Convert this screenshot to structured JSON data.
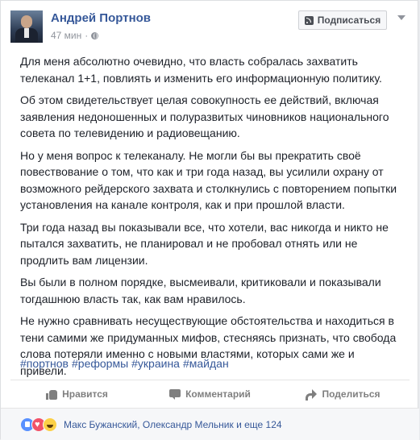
{
  "post": {
    "author": "Андрей Портнов",
    "time": "47 мин",
    "subscribe_label": "Подписаться",
    "paragraphs": [
      "Для меня абсолютно очевидно, что власть собралась захватить телеканал 1+1, повлиять и изменить его информационную политику.",
      "Об этом свидетельствует целая совокупность ее действий, включая заявления недоношенных и полуразвитых чиновников национального совета по телевидению и радиовещанию.",
      "Но у меня вопрос к телеканалу. Не могли бы вы прекратить своё повествование о том, что как и три года назад, вы усилили охрану от возможного рейдерского захвата и столкнулись с повторением попытки установления на канале контроля, как и при прошлой власти.",
      "Три года назад вы показывали все, что хотели, вас никогда и никто не пытался захватить, не планировал и не пробовал отнять или не продлить вам лицензии.",
      "Вы были в полном порядке, высмеивали, критиковали и показывали тогдашнюю власть так, как вам нравилось.",
      "Не нужно сравнивать несуществующие обстоятельства и находиться в тени самими же придуманных мифов, стесняясь признать, что свобода слова потеряли именно с новыми властями, которых сами же и привели."
    ],
    "hashtags": [
      "#портнов",
      "#реформы",
      "#украина",
      "#майдан"
    ]
  },
  "actions": {
    "like": "Нравится",
    "comment": "Комментарий",
    "share": "Поделиться"
  },
  "reactions": {
    "summary": "Макс Бужанский, Олександр Мельник и еще 124"
  },
  "colors": {
    "link": "#365899",
    "text": "#1d2129",
    "muted": "#90949c"
  }
}
